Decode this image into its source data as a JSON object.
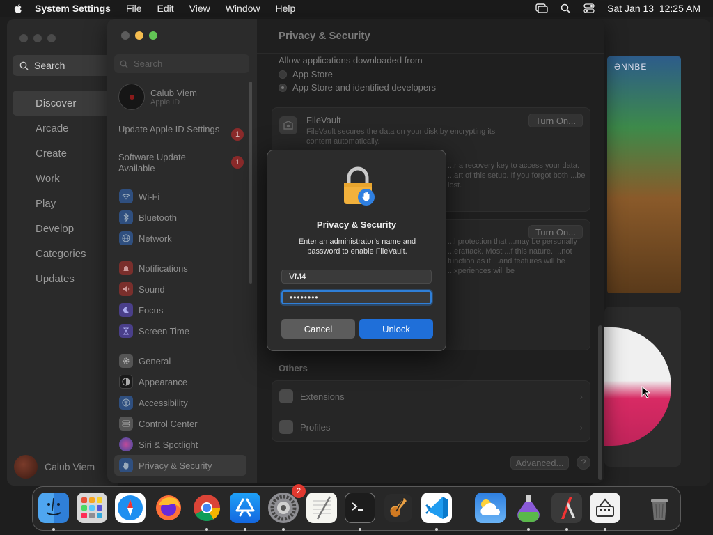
{
  "menubar": {
    "app_name": "System Settings",
    "menus": [
      "File",
      "Edit",
      "View",
      "Window",
      "Help"
    ],
    "clock": "Sat Jan 13  12:25 AM"
  },
  "appstore": {
    "search_placeholder": "Search",
    "nav": [
      "Discover",
      "Arcade",
      "Create",
      "Work",
      "Play",
      "Develop",
      "Categories",
      "Updates"
    ],
    "active_nav": "Discover",
    "user_name": "Calub Viem",
    "art_label": "ƏNNBE"
  },
  "settings": {
    "search_placeholder": "Search",
    "account": {
      "name": "Calub Viem",
      "subtitle": "Apple ID"
    },
    "alerts": [
      {
        "label": "Update Apple ID Settings",
        "badge": "1"
      },
      {
        "label": "Software Update Available",
        "badge": "1"
      }
    ],
    "groups": [
      [
        {
          "label": "Wi-Fi",
          "icon": "wifi-icon",
          "color": "#2f6fcf"
        },
        {
          "label": "Bluetooth",
          "icon": "bluetooth-icon",
          "color": "#2f6fcf"
        },
        {
          "label": "Network",
          "icon": "globe-icon",
          "color": "#2f6fcf"
        }
      ],
      [
        {
          "label": "Notifications",
          "icon": "bell-icon",
          "color": "#c9403a"
        },
        {
          "label": "Sound",
          "icon": "speaker-icon",
          "color": "#c9403a"
        },
        {
          "label": "Focus",
          "icon": "moon-icon",
          "color": "#5b4fc9"
        },
        {
          "label": "Screen Time",
          "icon": "hourglass-icon",
          "color": "#5b4fc9"
        }
      ],
      [
        {
          "label": "General",
          "icon": "gear-icon",
          "color": "#6a6a6a"
        },
        {
          "label": "Appearance",
          "icon": "appearance-icon",
          "color": "#222222"
        },
        {
          "label": "Accessibility",
          "icon": "accessibility-icon",
          "color": "#2f6fcf"
        },
        {
          "label": "Control Center",
          "icon": "control-center-icon",
          "color": "#6a6a6a"
        },
        {
          "label": "Siri & Spotlight",
          "icon": "siri-icon",
          "color": "#a04090"
        },
        {
          "label": "Privacy & Security",
          "icon": "hand-icon",
          "color": "#2f6fcf"
        }
      ]
    ],
    "active_item": "Privacy & Security",
    "page_title": "Privacy & Security",
    "downloads": {
      "label": "Allow applications downloaded from",
      "options": [
        "App Store",
        "App Store and identified developers"
      ],
      "selected": "App Store and identified developers"
    },
    "filevault": {
      "title": "FileVault",
      "desc": "FileVault secures the data on your disk by encrypting its content automatically.",
      "partial_desc": "...r a recovery key to access your data. ...art of this setup. If you forgot both ...be lost.",
      "button": "Turn On..."
    },
    "lockdown": {
      "partial_desc": "...l protection that ...may be personally ...erattack. Most ...f this nature. ...not function as it ...and features will be ...xperiences will be",
      "button": "Turn On..."
    },
    "others_title": "Others",
    "others": [
      "Extensions",
      "Profiles"
    ],
    "advanced_button": "Advanced...",
    "help_button": "?"
  },
  "dialog": {
    "title": "Privacy & Security",
    "message": "Enter an administrator’s name and password to enable FileVault.",
    "username": "VM4",
    "password": "••••••••",
    "cancel_label": "Cancel",
    "unlock_label": "Unlock"
  },
  "dock": {
    "apps": [
      "Finder",
      "Launchpad",
      "Safari",
      "Firefox",
      "Chrome",
      "App Store",
      "System Settings",
      "TextEdit",
      "Terminal",
      "GarageBand",
      "VS Code",
      "Weather",
      "Potion",
      "Developer Tool",
      "Utility",
      "Trash"
    ],
    "system_settings_badge": "2"
  }
}
